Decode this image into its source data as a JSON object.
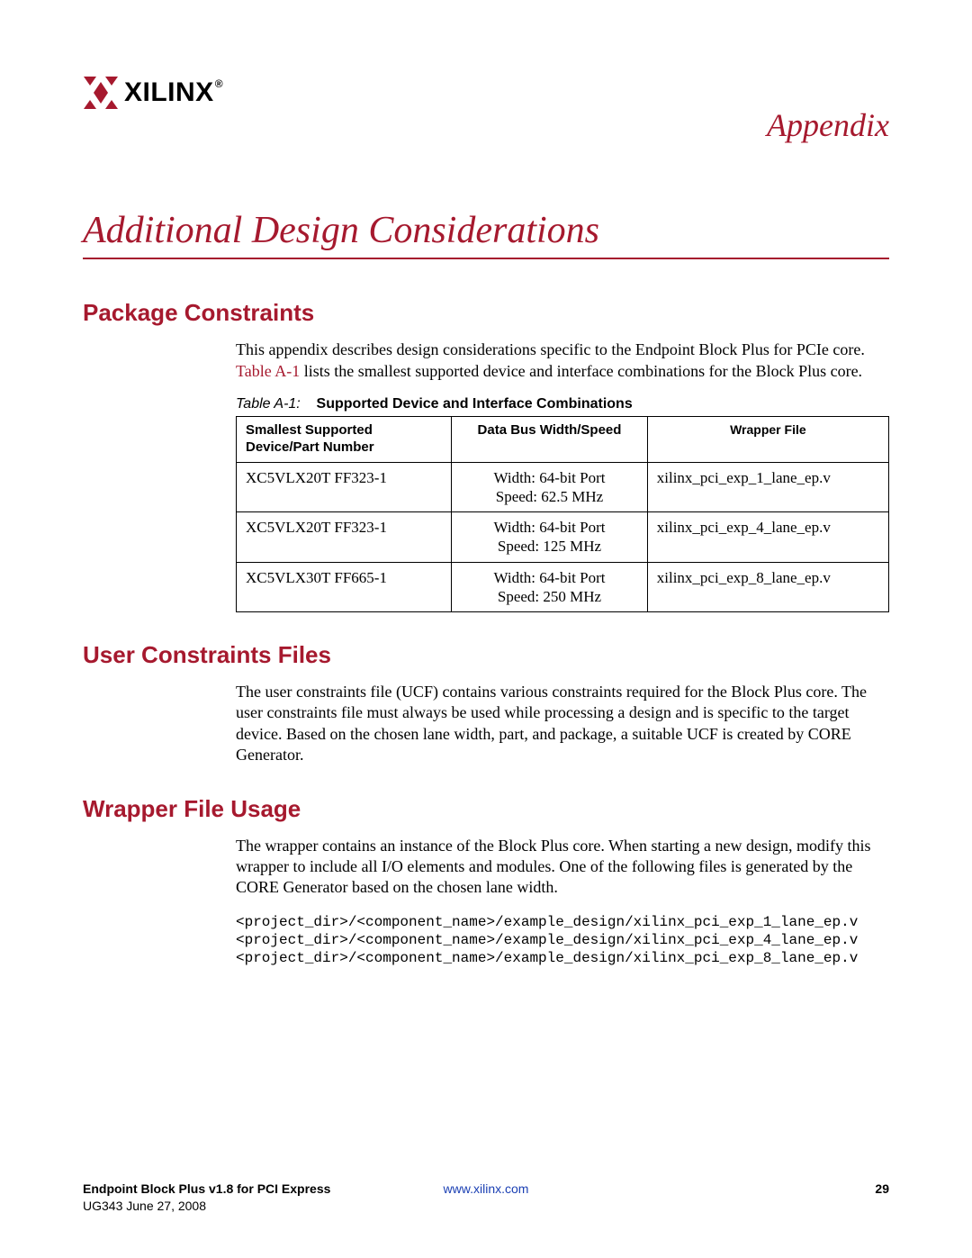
{
  "header": {
    "brand": "XILINX",
    "appendix_label": "Appendix",
    "chapter_title": "Additional Design Considerations"
  },
  "sections": {
    "package_constraints": {
      "title": "Package Constraints",
      "para_pre": "This appendix describes design considerations specific to the Endpoint Block Plus for PCIe core. ",
      "xref": "Table A-1",
      "para_post": " lists the smallest supported device and interface combinations for the Block Plus core."
    },
    "ucf": {
      "title": "User Constraints Files",
      "para": "The user constraints file (UCF) contains various constraints required for the Block Plus core. The user constraints file must always be used while processing a design and is specific to the target device. Based on the chosen lane width, part, and package, a suitable UCF is created by CORE Generator."
    },
    "wrapper": {
      "title": "Wrapper File Usage",
      "para": "The wrapper contains an instance of the Block Plus core. When starting a new design, modify this wrapper to include all I/O elements and modules. One of the following files is generated by the CORE Generator based on the chosen lane width.",
      "code": "<project_dir>/<component_name>/example_design/xilinx_pci_exp_1_lane_ep.v\n<project_dir>/<component_name>/example_design/xilinx_pci_exp_4_lane_ep.v\n<project_dir>/<component_name>/example_design/xilinx_pci_exp_8_lane_ep.v"
    }
  },
  "table": {
    "caption_num": "Table A-1:",
    "caption_text": "Supported Device and Interface Combinations",
    "headers": {
      "c1": "Smallest Supported Device/Part Number",
      "c2": "Data Bus Width/Speed",
      "c3": "Wrapper File"
    },
    "rows": [
      {
        "c1": "XC5VLX20T FF323-1",
        "c2": "Width: 64-bit Port\nSpeed: 62.5 MHz",
        "c3": "xilinx_pci_exp_1_lane_ep.v"
      },
      {
        "c1": "XC5VLX20T FF323-1",
        "c2": "Width: 64-bit Port\nSpeed: 125 MHz",
        "c3": "xilinx_pci_exp_4_lane_ep.v"
      },
      {
        "c1": "XC5VLX30T FF665-1",
        "c2": "Width: 64-bit Port\nSpeed: 250 MHz",
        "c3": "xilinx_pci_exp_8_lane_ep.v"
      }
    ]
  },
  "footer": {
    "doc_title": "Endpoint Block Plus v1.8 for PCI Express",
    "doc_sub": "UG343 June 27, 2008",
    "link": "www.xilinx.com",
    "page": "29"
  }
}
